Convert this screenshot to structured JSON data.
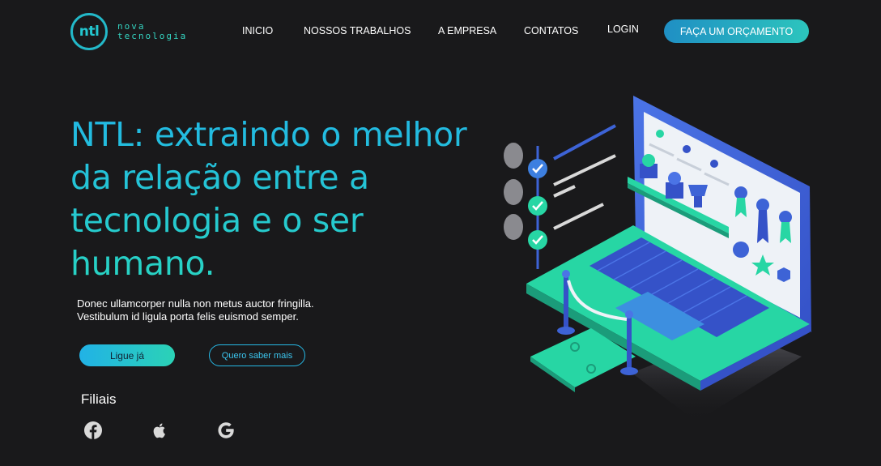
{
  "brand": {
    "logo_mark": "ntl",
    "name_line1": "nova",
    "name_line2": "tecnologia"
  },
  "nav": {
    "items": [
      "INICIO",
      "NOSSOS TRABALHOS",
      "A EMPRESA",
      "CONTATOS",
      "LOGIN"
    ],
    "cta_label": "FAÇA UM ORÇAMENTO"
  },
  "hero": {
    "headline_lines": [
      "NTL: extraindo o melhor",
      "da relação entre a",
      "tecnologia e o ser",
      "humano."
    ],
    "subtext_lines": [
      "Donec ullamcorper nulla non metus auctor fringilla.",
      "Vestibulum id ligula porta felis euismod semper."
    ],
    "primary_button": "Ligue já",
    "secondary_button": "Quero saber mais"
  },
  "branches": {
    "title": "Filiais",
    "icons": [
      "facebook-icon",
      "apple-icon",
      "google-icon"
    ]
  },
  "colors": {
    "background": "#19191b",
    "accent_blue": "#21b2e6",
    "accent_teal": "#2bd2b6",
    "laptop_blue": "#3d63d6",
    "green": "#27d6a4"
  }
}
